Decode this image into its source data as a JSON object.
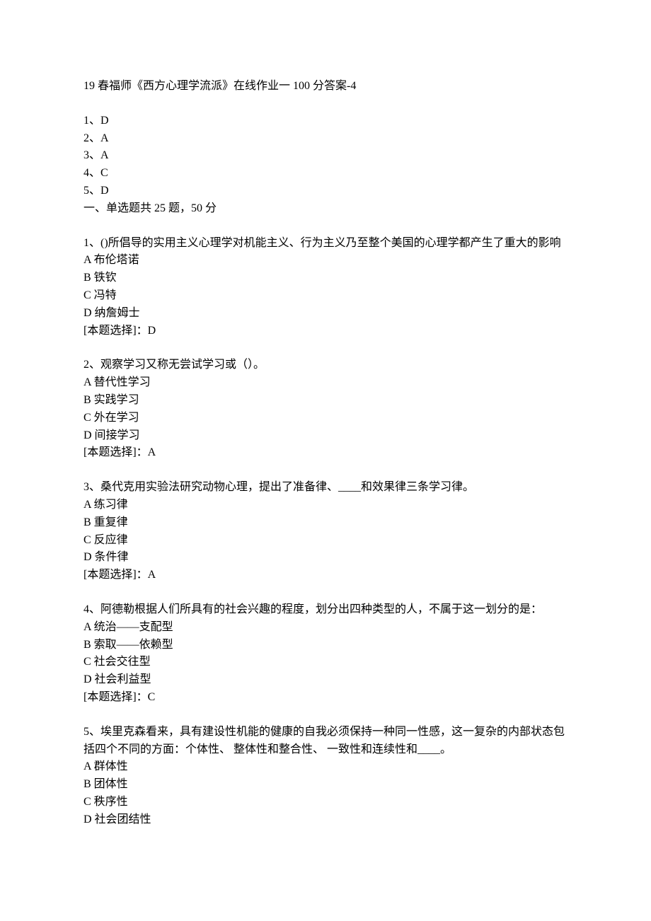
{
  "title": "19 春福师《西方心理学流派》在线作业一 100 分答案-4",
  "answers": [
    "1、D",
    "2、A",
    "3、A",
    "4、C",
    "5、D"
  ],
  "section_intro": "一、单选题共 25 题，50 分",
  "questions": [
    {
      "stem": "1、()所倡导的实用主义心理学对机能主义、行为主义乃至整个美国的心理学都产生了重大的影响",
      "options": [
        "A 布伦塔诺",
        "B 铁钦",
        "C 冯特",
        "D 纳詹姆士"
      ],
      "answer": "[本题选择]：D"
    },
    {
      "stem": "2、观察学习又称无尝试学习或（）。",
      "options": [
        "A 替代性学习",
        "B 实践学习",
        "C 外在学习",
        "D 间接学习"
      ],
      "answer": "[本题选择]：A"
    },
    {
      "stem": "3、桑代克用实验法研究动物心理，提出了准备律、____和效果律三条学习律。",
      "options": [
        "A 练习律",
        "B 重复律",
        "C 反应律",
        "D 条件律"
      ],
      "answer": "[本题选择]：A"
    },
    {
      "stem": "4、阿德勒根据人们所具有的社会兴趣的程度，划分出四种类型的人，不属于这一划分的是：",
      "options": [
        "A 统治——支配型",
        "B 索取——依赖型",
        "C 社会交往型",
        "D 社会利益型"
      ],
      "answer": "[本题选择]：C"
    },
    {
      "stem": "5、埃里克森看来，具有建设性机能的健康的自我必须保持一种同一性感，这一复杂的内部状态包括四个不同的方面：个体性、 整体性和整合性、 一致性和连续性和____。",
      "options": [
        "A 群体性",
        "B 团体性",
        "C 秩序性",
        "D 社会团结性"
      ],
      "answer": ""
    }
  ]
}
